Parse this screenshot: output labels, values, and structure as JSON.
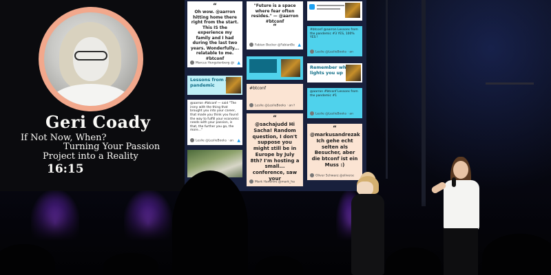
{
  "slide": {
    "speaker_name": "Geri Coady",
    "talk_title_line1": "If Not Now, When?",
    "talk_title_line2": "Turning Your Passion",
    "talk_title_line3": "Project into a Reality",
    "time": "16:15"
  },
  "tweet_wall": {
    "cards": [
      {
        "quote_mark": "“",
        "text": "Oh wow. @aarron hitting home there right from the start. This IS the experience my family and I had during the last two years. Wonderfully... relatable to me. #btconf",
        "author": "Marcus Hengstenberg @itsmarc · an hour ago"
      },
      {
        "quote_mark": "“",
        "text": "\"Future is a space where fear often resides.\" — @aarron #btconf",
        "author": "Fabian Becker @FabianBecker · an hour ago"
      },
      {
        "banner": "Lessons from a pandemic"
      },
      {
        "text": "@aarron #btconf — said \"The irony with the thing that brought you into your career, that made you think you found the way to fulfill your economic needs with your passion, is that, the further you go, the more...\"",
        "author": "Leslie @LeslieBooks · an hour ago"
      },
      {
        "text": "#btconf",
        "author": "Leslie @LeslieBooks · an hour ago"
      },
      {
        "quote_mark": "“",
        "text": "@sachajudd Hi Sacha! Random question, I don't suppose you might still be in Europe by July 8th? I'm hosting a small... conference, saw your",
        "author": "Mark Hanshire @mark_hans · an hour ago"
      },
      {
        "text": "#btconf @aarron Lessons from the pandemic #3 YES, 100% YES !",
        "author": "Leslie @LeslieBooks · an hour ago"
      },
      {
        "banner": "Remember what lights you up"
      },
      {
        "text": "@aarron #btconf Lessons from the pandemic #1",
        "author": "Leslie @LeslieBooks · an hour ago"
      },
      {
        "quote_mark": "“",
        "text": "@markusandrezak Ich gehe echt selten als Besucher, aber die btconf ist ein Muss :)",
        "author": "Oliver Schwarz @oliverschw · an hour ago"
      }
    ]
  },
  "colors": {
    "portrait_ring": "#f2a88c",
    "wall_background": "#18203c",
    "card_cyan": "#4fd2ec",
    "card_peach": "#fbe4d3",
    "stage_glow": "#a046ff"
  },
  "icons": [
    "twitter-bird-icon",
    "quote-mark-icon"
  ]
}
